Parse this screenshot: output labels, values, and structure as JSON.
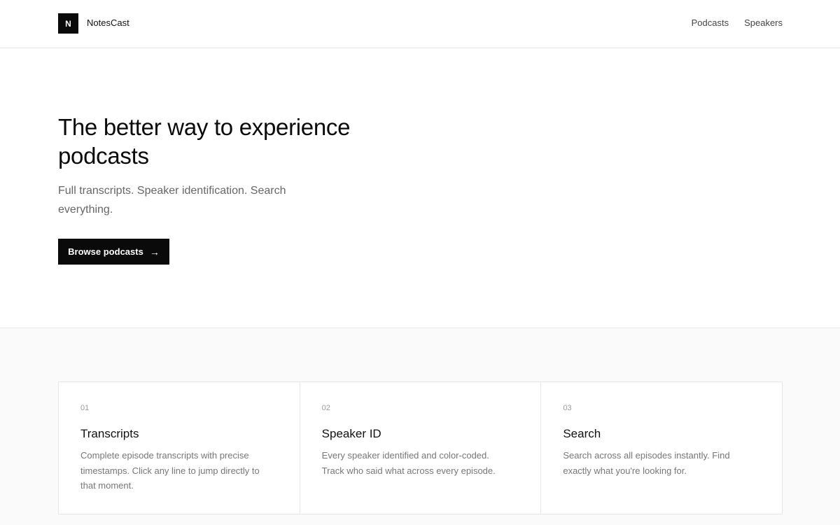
{
  "header": {
    "logo_letter": "N",
    "brand": "NotesCast",
    "nav": [
      "Podcasts",
      "Speakers"
    ]
  },
  "hero": {
    "title": "The better way to experience podcasts",
    "subtitle": "Full transcripts. Speaker identification. Search everything.",
    "cta_label": "Browse podcasts",
    "cta_icon": "arrow-right-icon"
  },
  "features": [
    {
      "number": "01",
      "title": "Transcripts",
      "description": "Complete episode transcripts with precise timestamps. Click any line to jump directly to that moment."
    },
    {
      "number": "02",
      "title": "Speaker ID",
      "description": "Every speaker identified and color-coded. Track who said what across every episode."
    },
    {
      "number": "03",
      "title": "Search",
      "description": "Search across all episodes instantly. Find exactly what you're looking for."
    }
  ],
  "colors": {
    "primary": "#0a0a0a",
    "background": "#ffffff",
    "section_background": "#fafafa",
    "border": "#e6e6e6"
  }
}
